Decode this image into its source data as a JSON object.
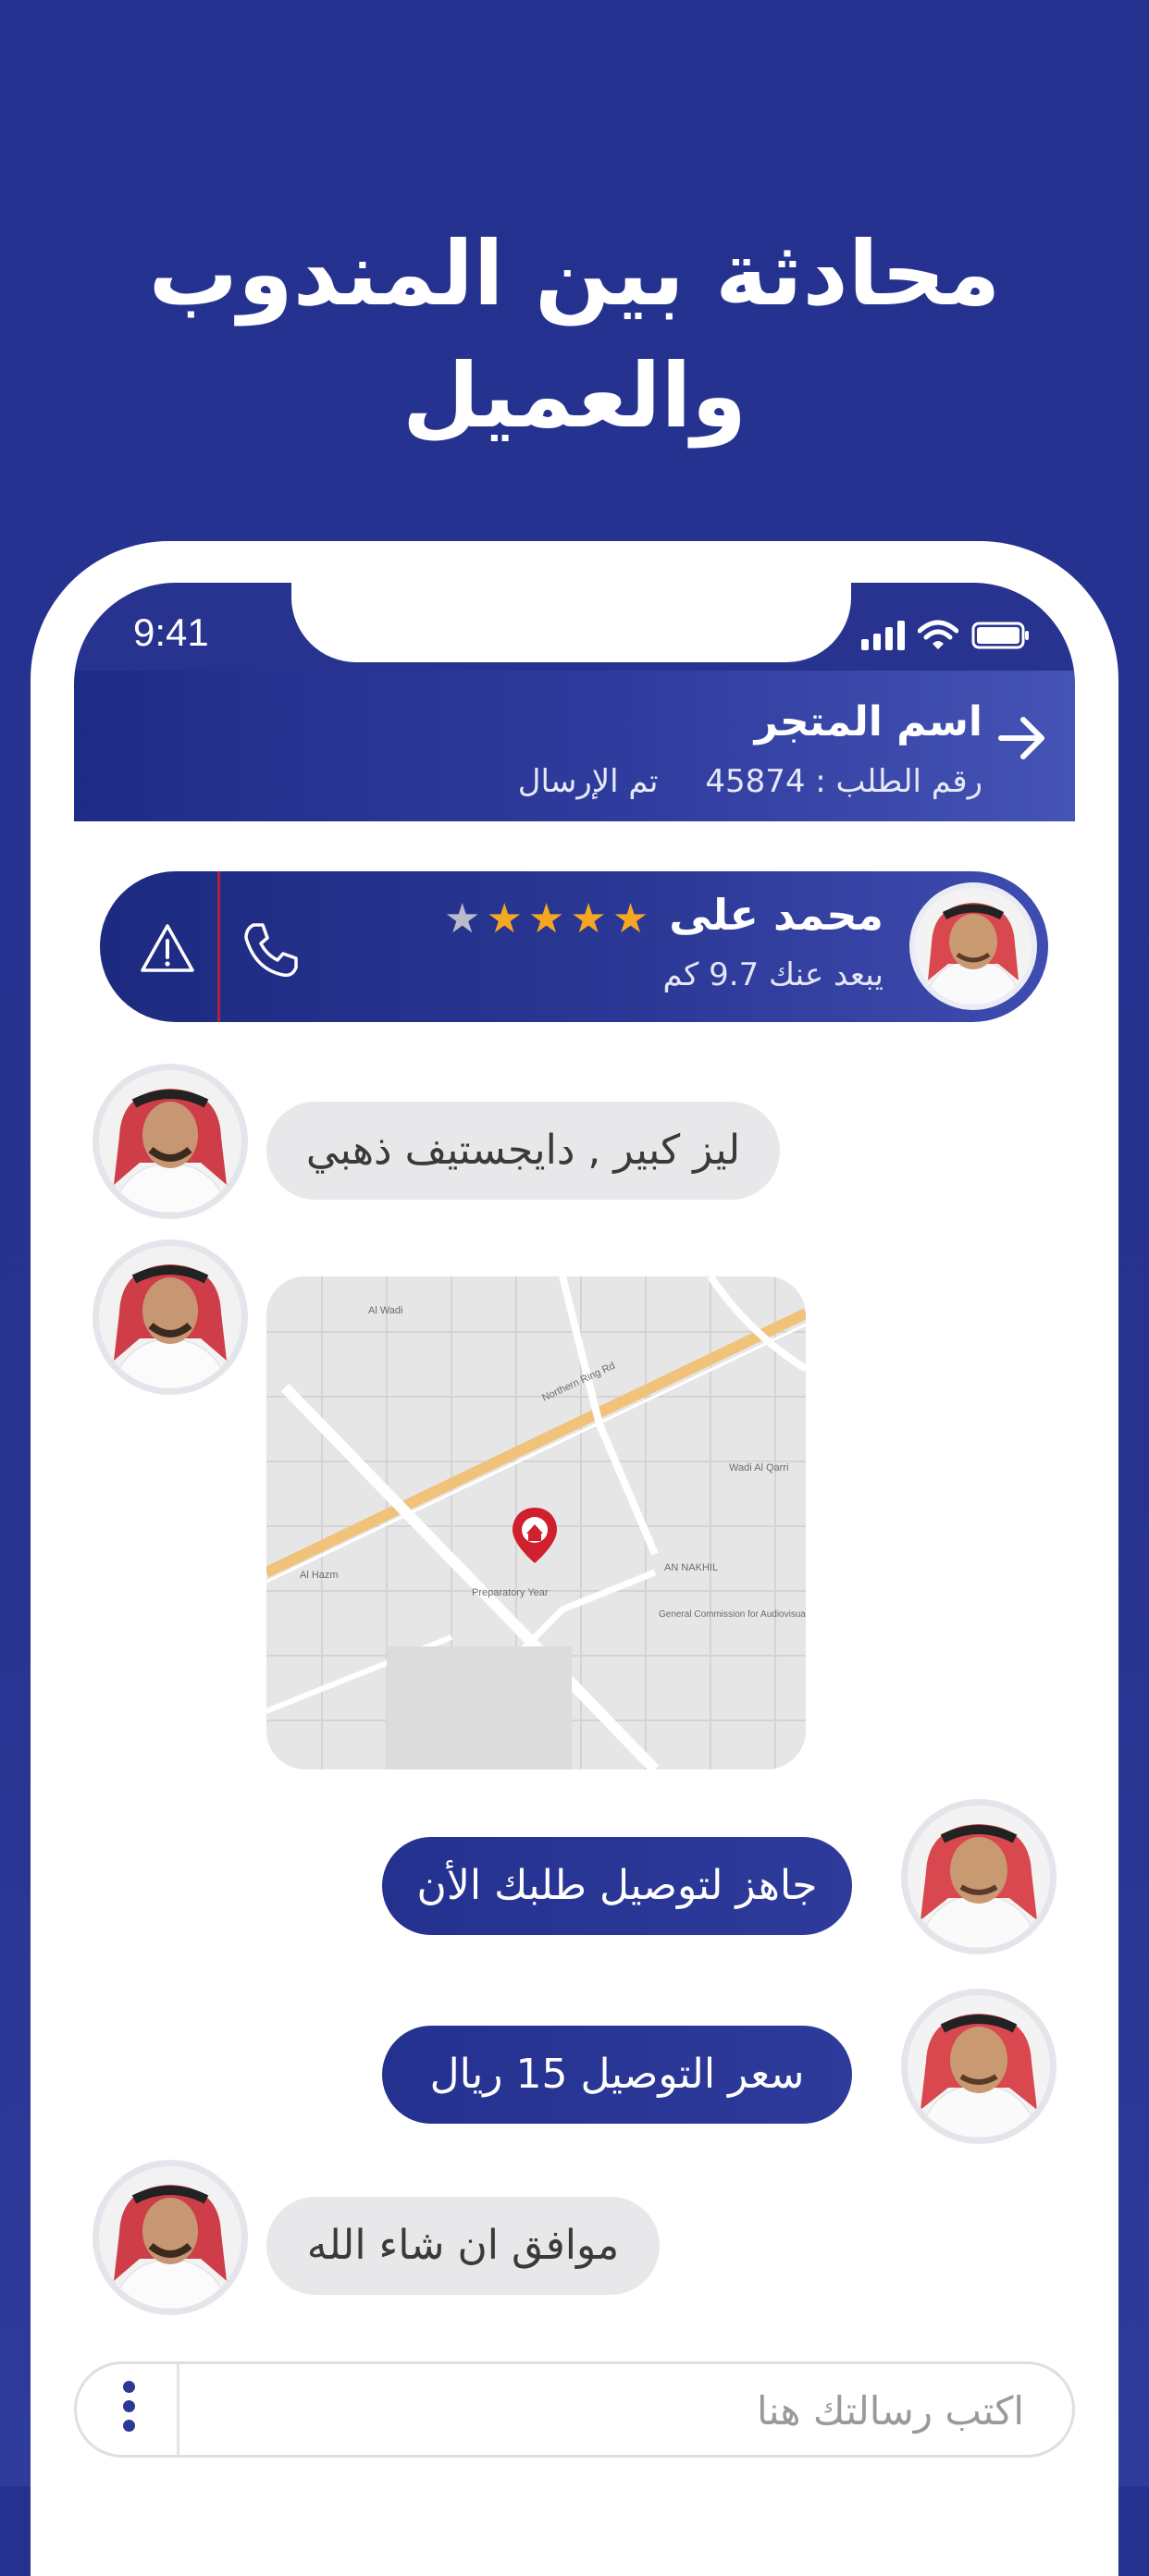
{
  "promo": {
    "headline_line1": "محادثة بين المندوب",
    "headline_line2": "والعميل"
  },
  "status_bar": {
    "time": "9:41",
    "icons": [
      "signal-icon",
      "wifi-icon",
      "battery-icon"
    ]
  },
  "header": {
    "store_name": "اسم المتجر",
    "order_label": "رقم الطلب : 45874",
    "status": "تم الإرسال",
    "back_icon": "arrow-right-icon"
  },
  "driver": {
    "name": "محمد على",
    "distance": "يبعد عنك 9.7 كم",
    "rating": 4,
    "rating_max": 5,
    "icons": [
      "phone-icon",
      "warning-icon"
    ]
  },
  "messages": [
    {
      "sender": "customer",
      "type": "text",
      "text": "ليز كبير , دايجستيف ذهبي"
    },
    {
      "sender": "customer",
      "type": "map",
      "map_labels": [
        "Northern Ring Rd",
        "Al Wadi",
        "Preparatory Year",
        "AN NAKHIL",
        "General Commission for Audiovisual Media",
        "Al Hazm",
        "Wadi Al Qarri"
      ]
    },
    {
      "sender": "driver",
      "type": "text",
      "text": "جاهز لتوصيل طلبك الأن"
    },
    {
      "sender": "driver",
      "type": "text",
      "text": "سعر التوصيل  15 ريال"
    },
    {
      "sender": "customer",
      "type": "text",
      "text": "موافق ان شاء الله"
    }
  ],
  "composer": {
    "placeholder": "اكتب رسالتك هنا",
    "value": "",
    "menu_icon": "more-vertical-icon"
  },
  "colors": {
    "brand_blue": "#27338f",
    "star": "#f5a623",
    "incoming_bubble": "#e8e8ea",
    "alert_divider": "#b0233a"
  }
}
